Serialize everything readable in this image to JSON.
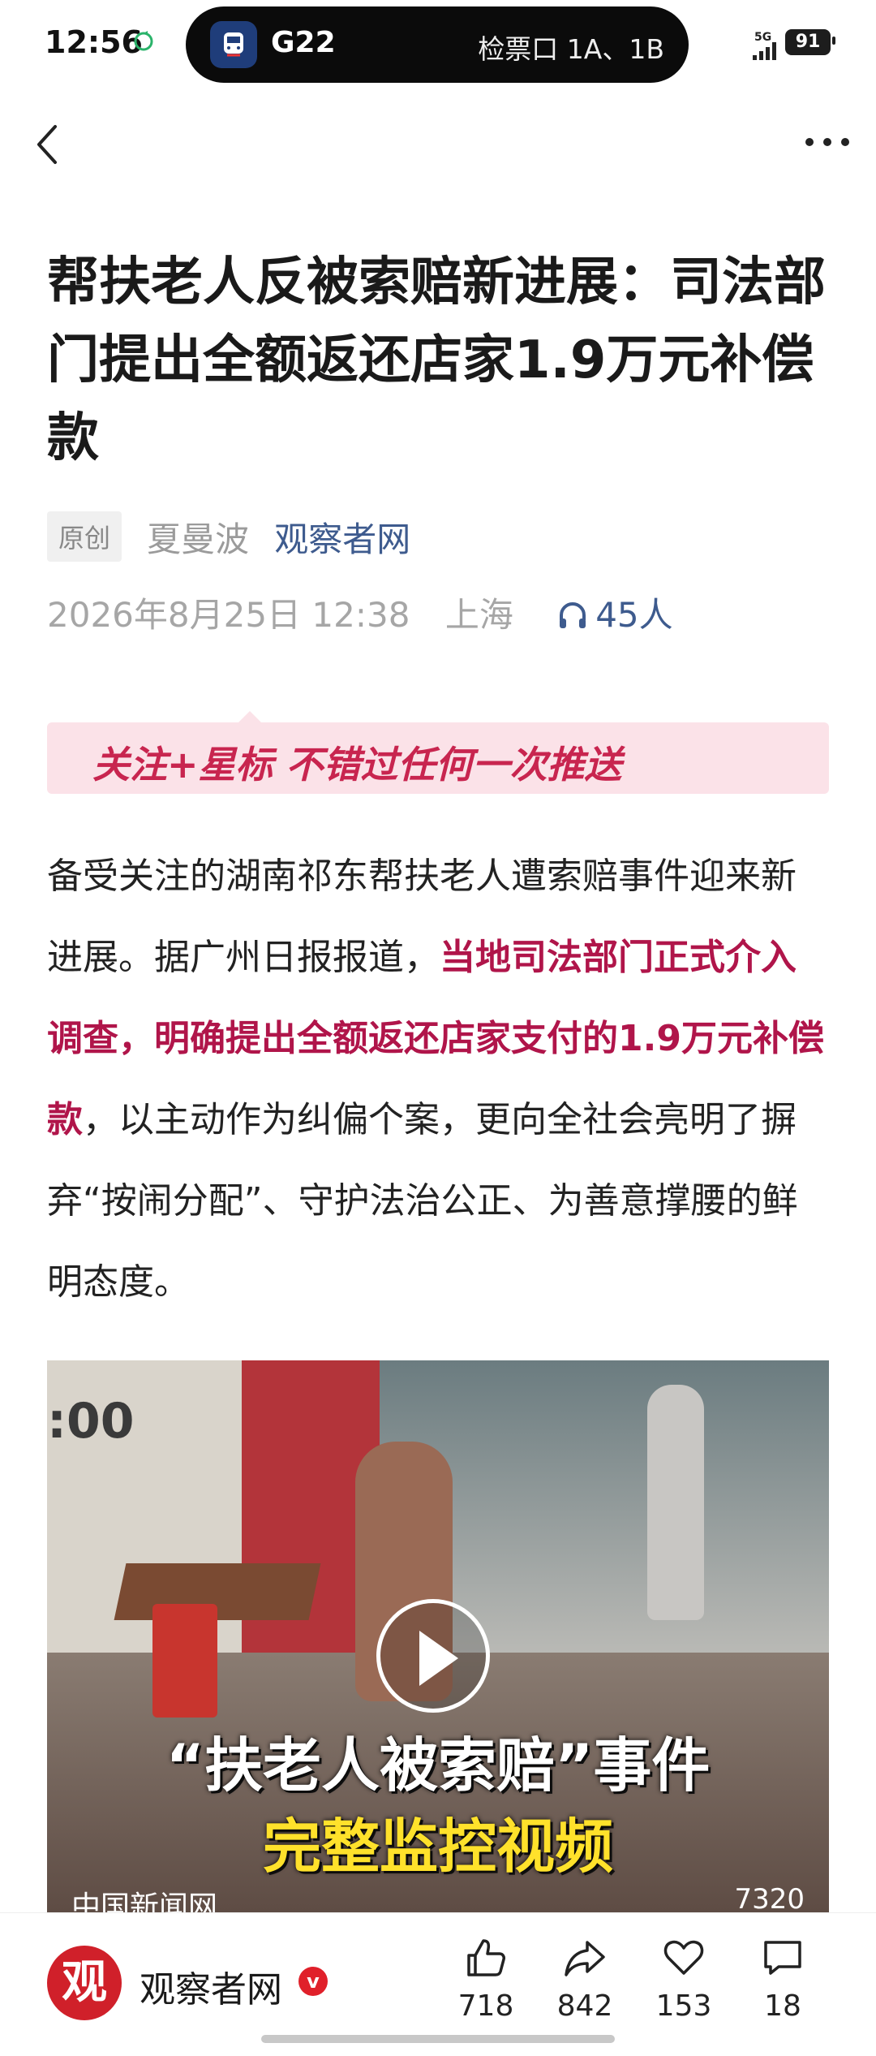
{
  "status_bar": {
    "time": "12:56",
    "route": "G22",
    "gate": "检票口 1A、1B",
    "network": "5G",
    "battery": "91"
  },
  "article": {
    "title": "帮扶老人反被索赔新进展：司法部门提出全额返还店家1.9万元补偿款",
    "tag": "原创",
    "author": "夏曼波",
    "source": "观察者网",
    "date": "2026年8月25日 12:38",
    "location": "上海",
    "listeners": "45人",
    "follow_banner": "关注+星标 不错过任何一次推送",
    "body_part1": "备受关注的湖南祁东帮扶老人遭索赔事件迎来新进展。据广州日报报道，",
    "body_highlight": "当地司法部门正式介入调查，明确提出全额返还店家支付的1.9万元补偿款",
    "body_part2": "，以主动作为纠偏个案，更向全社会亮明了摒弃“按闹分配”、守护法治公正、为善意撑腰的鲜明态度。"
  },
  "video": {
    "clock": ":00",
    "caption_line1": "“扶老人被索赔”事件",
    "caption_line2": "完整监控视频",
    "source": "中国新闻网",
    "likes": "7320"
  },
  "bottom_bar": {
    "brand_logo": "观",
    "brand_name": "观察者网",
    "verified": "v",
    "like_count": "718",
    "share_count": "842",
    "favorite_count": "153",
    "comment_count": "18"
  }
}
